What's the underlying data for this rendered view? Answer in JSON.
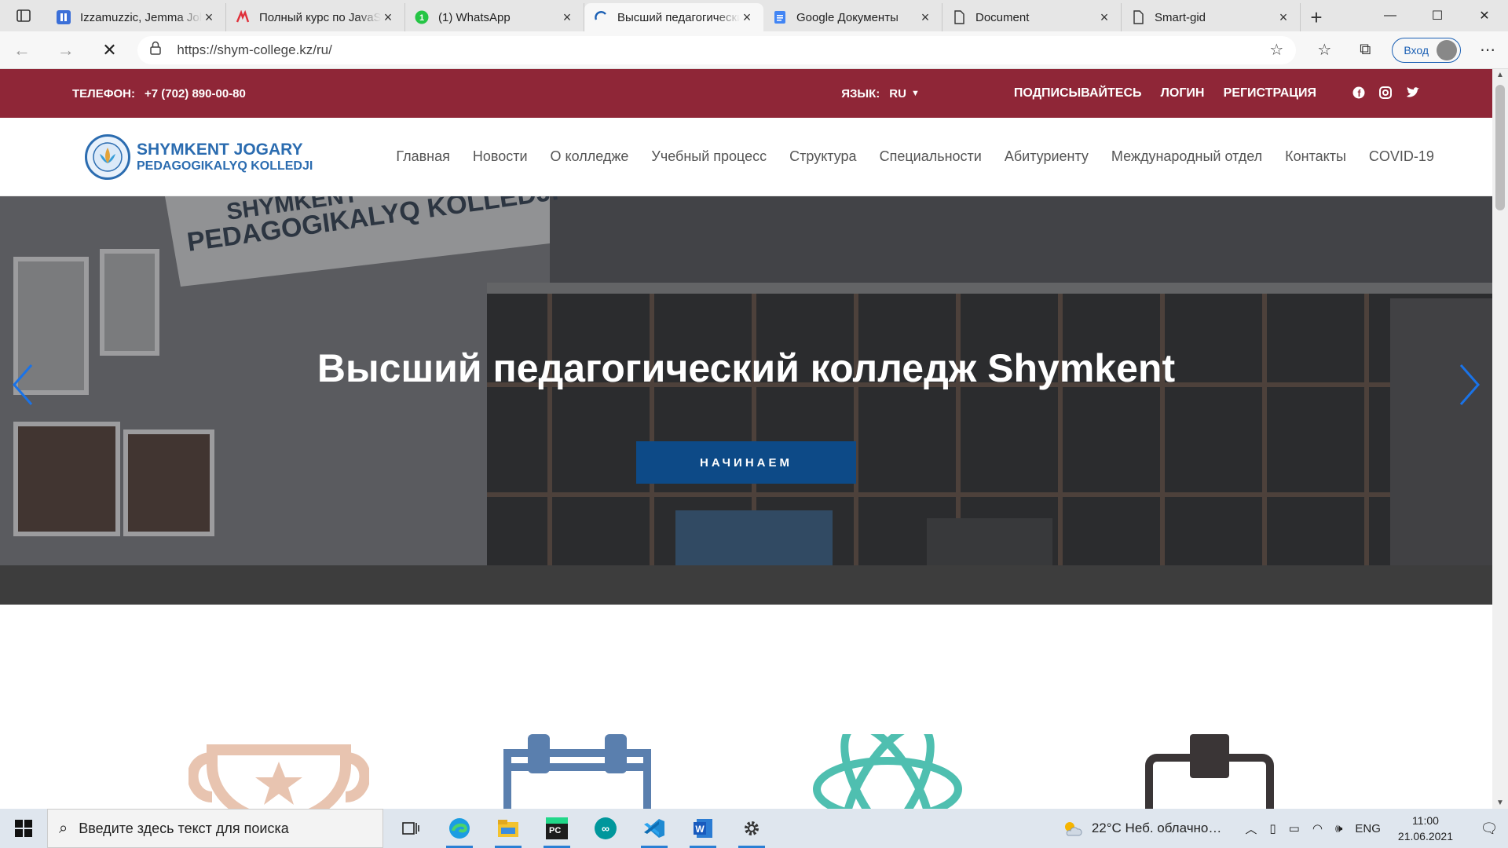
{
  "browser": {
    "tabs": [
      {
        "title": "Izzamuzzic, Jemma Johnson",
        "icon": "blue-pause-icon",
        "active": false
      },
      {
        "title": "Полный курс по JavaScript",
        "icon": "red-logo-icon",
        "active": false
      },
      {
        "title": "(1) WhatsApp",
        "icon": "whatsapp-icon",
        "active": false
      },
      {
        "title": "Высший педагогический колледж",
        "icon": "loading-spinner-icon",
        "active": true
      },
      {
        "title": "Google Документы",
        "icon": "google-docs-icon",
        "active": false
      },
      {
        "title": "Document",
        "icon": "page-icon",
        "active": false
      },
      {
        "title": "Smart-gid",
        "icon": "page-icon",
        "active": false
      }
    ],
    "url": "https://shym-college.kz/ru/",
    "signin_label": "Вход",
    "window_controls": {
      "minimize": "—",
      "maximize": "☐",
      "close": "✕"
    }
  },
  "site": {
    "topbar": {
      "phone_label": "ТЕЛЕФОН:",
      "phone": "+7 (702) 890-00-80",
      "lang_label": "ЯЗЫК:",
      "lang_value": "RU",
      "subscribe": "ПОДПИСЫВАЙТЕСЬ",
      "login": "ЛОГИН",
      "register": "РЕГИСТРАЦИЯ",
      "social": [
        "facebook-icon",
        "instagram-icon",
        "twitter-icon"
      ]
    },
    "logo": {
      "line1": "SHYMKENT JOGARY",
      "line2": "PEDAGOGIKALYQ KOLLEDJI"
    },
    "menu": [
      "Главная",
      "Новости",
      "О колледже",
      "Учебный процесс",
      "Структура",
      "Специальности",
      "Абитуриенту",
      "Международный отдел",
      "Контакты",
      "COVID-19"
    ],
    "hero": {
      "title": "Высший педагогический колледж Shymkent",
      "cta": "НАЧИНАЕМ",
      "building_sign_line1": "SHYMKENT",
      "building_sign_line2": "PEDAGOGIKALYQ KOLLEDJI"
    },
    "feature_icons": [
      "trophy-icon",
      "calendar-icon",
      "atom-icon",
      "clipboard-icon"
    ],
    "colors": {
      "topbar": "#8f2637",
      "brand_blue": "#2b6cb0",
      "cta": "#0d4a87"
    }
  },
  "taskbar": {
    "search_placeholder": "Введите здесь текст для поиска",
    "apps": [
      "task-view-icon",
      "edge-icon",
      "file-explorer-icon",
      "pycharm-icon",
      "arduino-icon",
      "vscode-icon",
      "word-icon",
      "settings-icon"
    ],
    "weather": "22°C  Неб. облачно…",
    "lang": "ENG",
    "time": "11:00",
    "date": "21.06.2021"
  }
}
